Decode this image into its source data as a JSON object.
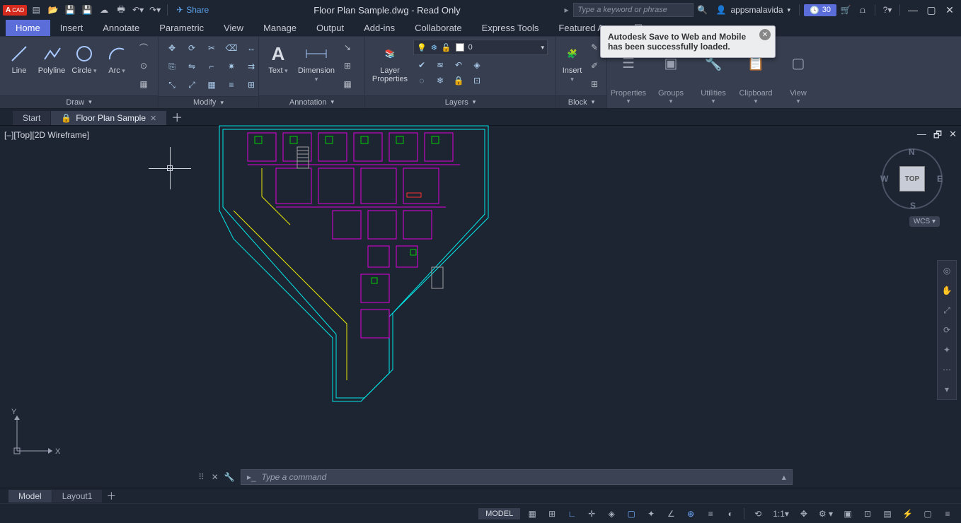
{
  "app": {
    "badge": "A",
    "badge_suffix": "CAD",
    "title": "Floor Plan Sample.dwg - Read Only"
  },
  "qat": {
    "share": "Share"
  },
  "search": {
    "placeholder": "Type a keyword or phrase"
  },
  "user": {
    "name": "appsmalavida"
  },
  "timer": {
    "value": "30"
  },
  "ribbon_tabs": [
    "Home",
    "Insert",
    "Annotate",
    "Parametric",
    "View",
    "Manage",
    "Output",
    "Add-ins",
    "Collaborate",
    "Express Tools",
    "Featured Apps"
  ],
  "ribbon": {
    "draw": {
      "title": "Draw",
      "line": "Line",
      "polyline": "Polyline",
      "circle": "Circle",
      "arc": "Arc"
    },
    "modify": {
      "title": "Modify"
    },
    "annotation": {
      "title": "Annotation",
      "text": "Text",
      "dimension": "Dimension"
    },
    "layers": {
      "title": "Layers",
      "props": "Layer\nProperties",
      "current": "0"
    },
    "block": {
      "title": "Block",
      "insert": "Insert"
    },
    "collapsed": {
      "properties": "Properties",
      "groups": "Groups",
      "utilities": "Utilities",
      "clipboard": "Clipboard",
      "view": "View"
    }
  },
  "file_tabs": {
    "start": "Start",
    "doc": "Floor Plan Sample"
  },
  "viewport": {
    "label": "[–][Top][2D Wireframe]"
  },
  "viewcube": {
    "top": "TOP",
    "n": "N",
    "s": "S",
    "e": "E",
    "w": "W",
    "wcs": "WCS"
  },
  "command": {
    "placeholder": "Type a command"
  },
  "layout_tabs": {
    "model": "Model",
    "layout1": "Layout1"
  },
  "status": {
    "model": "MODEL",
    "scale": "1:1"
  },
  "balloon": {
    "text": "Autodesk Save to Web and Mobile has been successfully loaded."
  },
  "ucs": {
    "x": "X",
    "y": "Y"
  }
}
